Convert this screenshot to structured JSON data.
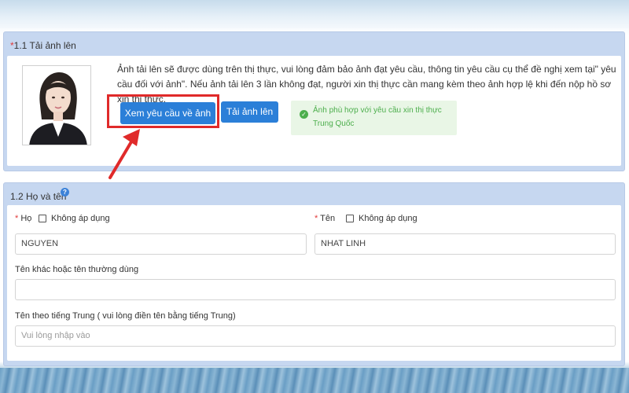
{
  "photo_section": {
    "title": "1.1 Tải ảnh lên",
    "required_mark": "*",
    "notice": "Ảnh tải lên sẽ được dùng trên thị thực, vui lòng đảm bảo ảnh đạt yêu cầu, thông tin yêu cầu cụ thể đề nghị xem tại\" yêu cầu đối với ảnh\". Nếu ảnh tải lên 3 lần không đạt, người xin thị thực cần mang kèm theo ảnh hợp lệ khi đến nộp hồ sơ xin thị thực.",
    "view_requirements_button": "Xem yêu cầu về ảnh",
    "upload_button": "Tải ảnh lên",
    "status_message": "Ảnh phù hợp với yêu cầu xin thị thực Trung Quốc",
    "status_icon": "check-circle-icon",
    "highlight_color": "#e02a2a"
  },
  "name_section": {
    "title": "1.2 Họ và tên",
    "help_icon": "question-circle-icon",
    "surname": {
      "required_mark": "*",
      "label": "Họ",
      "not_applicable_label": "Không áp dụng",
      "value": "NGUYEN"
    },
    "given_name": {
      "required_mark": "*",
      "label": "Tên",
      "not_applicable_label": "Không áp dụng",
      "value": "NHAT LINH"
    },
    "other_names": {
      "label": "Tên khác hoặc tên thường dùng",
      "value": ""
    },
    "chinese_name": {
      "label": "Tên theo tiếng Trung ( vui lòng điền tên bằng tiếng Trung)",
      "placeholder": "Vui lòng nhập vào"
    }
  },
  "colors": {
    "primary_button": "#2b7fd8",
    "panel_background": "#c6d7f0",
    "success_text": "#4cae4c",
    "success_background": "#e9f6e6",
    "required": "#e23b3b"
  }
}
